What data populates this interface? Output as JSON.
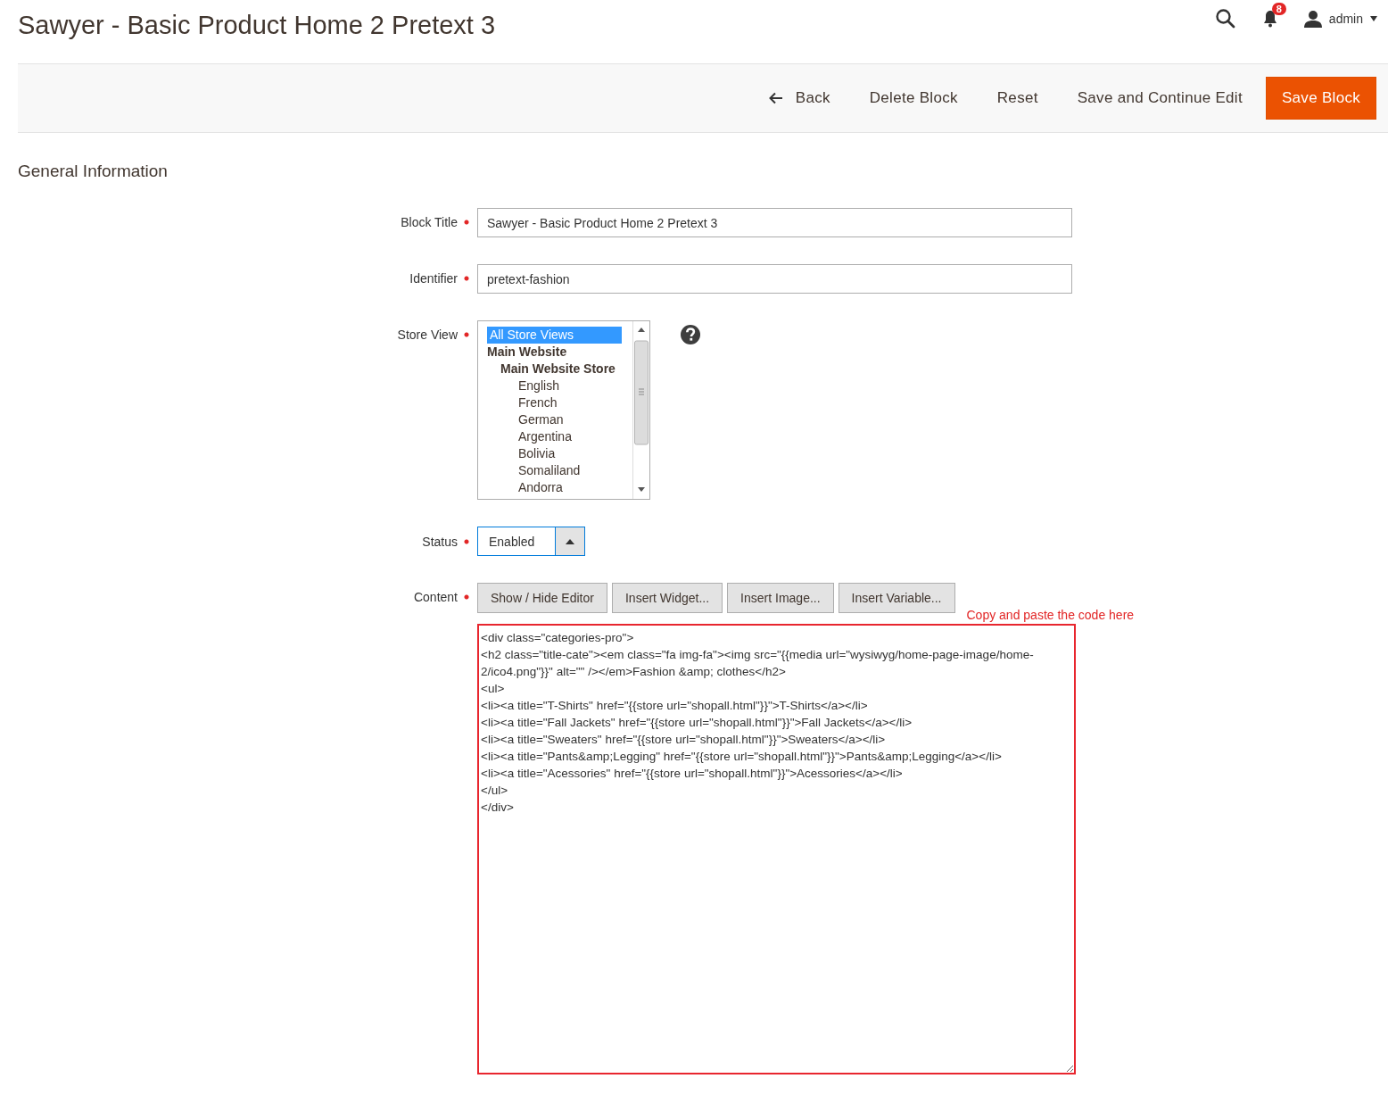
{
  "page_title": "Sawyer - Basic Product Home 2 Pretext 3",
  "header": {
    "notifications_count": "8",
    "user": "admin"
  },
  "toolbar": {
    "buttons": [
      {
        "label": "Back",
        "kind": "back"
      },
      {
        "label": "Delete Block",
        "kind": "plain"
      },
      {
        "label": "Reset",
        "kind": "plain"
      },
      {
        "label": "Save and Continue Edit",
        "kind": "plain"
      },
      {
        "label": "Save Block",
        "kind": "primary"
      }
    ]
  },
  "section_title": "General Information",
  "fields": [
    {
      "kind": "text",
      "label": "Block Title",
      "required": true,
      "value": "Sawyer - Basic Product Home 2 Pretext 3"
    },
    {
      "kind": "text",
      "label": "Identifier",
      "required": true,
      "value": "pretext-fashion"
    },
    {
      "kind": "multiselect",
      "label": "Store View",
      "required": true,
      "options": [
        {
          "label": "All Store Views",
          "selected": true
        },
        {
          "label": "Main Website",
          "selected": false,
          "children": [
            {
              "label": "Main Website Store",
              "selected": false,
              "children": [
                {
                  "label": "English",
                  "selected": false
                },
                {
                  "label": "French",
                  "selected": false
                },
                {
                  "label": "German",
                  "selected": false
                },
                {
                  "label": "Argentina",
                  "selected": false
                },
                {
                  "label": "Bolivia",
                  "selected": false
                },
                {
                  "label": "Somaliland",
                  "selected": false
                },
                {
                  "label": "Andorra",
                  "selected": false
                }
              ]
            }
          ]
        }
      ]
    },
    {
      "kind": "select",
      "label": "Status",
      "required": true,
      "value": "Enabled"
    },
    {
      "kind": "editor",
      "label": "Content",
      "required": true,
      "buttons": [
        "Show / Hide Editor",
        "Insert Widget...",
        "Insert Image...",
        "Insert Variable..."
      ],
      "note": "Copy and paste the code here",
      "value": "<div class=\"categories-pro\">\n<h2 class=\"title-cate\"><em class=\"fa img-fa\"><img src=\"{{media url=\"wysiwyg/home-page-image/home-2/ico4.png\"}}\" alt=\"\" /></em>Fashion &amp; clothes</h2>\n<ul>\n<li><a title=\"T-Shirts\" href=\"{{store url=\"shopall.html\"}}\">T-Shirts</a></li>\n<li><a title=\"Fall Jackets\" href=\"{{store url=\"shopall.html\"}}\">Fall Jackets</a></li>\n<li><a title=\"Sweaters\" href=\"{{store url=\"shopall.html\"}}\">Sweaters</a></li>\n<li><a title=\"Pants&amp;Legging\" href=\"{{store url=\"shopall.html\"}}\">Pants&amp;Legging</a></li>\n<li><a title=\"Acessories\" href=\"{{store url=\"shopall.html\"}}\">Acessories</a></li>\n</ul>\n</div>"
    }
  ]
}
